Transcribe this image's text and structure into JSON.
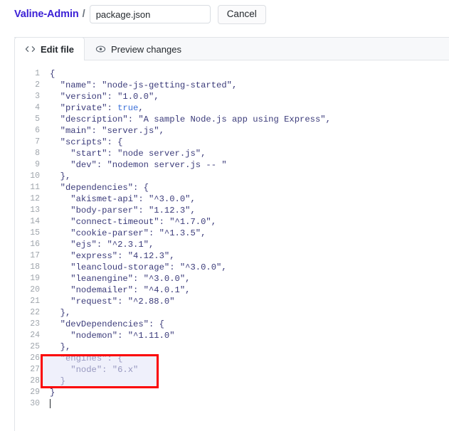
{
  "header": {
    "repo_name": "Valine-Admin",
    "path_separator": "/",
    "filename_value": "package.json",
    "filename_placeholder": "Name your file...",
    "cancel_label": "Cancel"
  },
  "tabs": [
    {
      "label": "Edit file",
      "icon": "code-icon",
      "active": true
    },
    {
      "label": "Preview changes",
      "icon": "eye-icon",
      "active": false
    }
  ],
  "editor": {
    "line_numbers": [
      "1",
      "2",
      "3",
      "4",
      "5",
      "6",
      "7",
      "8",
      "9",
      "10",
      "11",
      "12",
      "13",
      "14",
      "15",
      "16",
      "17",
      "18",
      "19",
      "20",
      "21",
      "22",
      "23",
      "24",
      "25",
      "26",
      "27",
      "28",
      "29",
      "30"
    ],
    "lines": [
      "{",
      "  \"name\": \"node-js-getting-started\",",
      "  \"version\": \"1.0.0\",",
      "  \"private\": true,",
      "  \"description\": \"A sample Node.js app using Express\",",
      "  \"main\": \"server.js\",",
      "  \"scripts\": {",
      "    \"start\": \"node server.js\",",
      "    \"dev\": \"nodemon server.js -- \"",
      "  },",
      "  \"dependencies\": {",
      "    \"akismet-api\": \"^3.0.0\",",
      "    \"body-parser\": \"1.12.3\",",
      "    \"connect-timeout\": \"^1.7.0\",",
      "    \"cookie-parser\": \"^1.3.5\",",
      "    \"ejs\": \"^2.3.1\",",
      "    \"express\": \"4.12.3\",",
      "    \"leancloud-storage\": \"^3.0.0\",",
      "    \"leanengine\": \"^3.0.0\",",
      "    \"nodemailer\": \"^4.0.1\",",
      "    \"request\": \"^2.88.0\"",
      "  },",
      "  \"devDependencies\": {",
      "    \"nodemon\": \"^1.11.0\"",
      "  },",
      "  \"engines\": {",
      "    \"node\": \"6.x\"",
      "  }",
      "}",
      ""
    ],
    "cursor_line": 30,
    "boolean_tokens": [
      "true"
    ]
  },
  "annotation": {
    "kind": "red-rectangle-highlight",
    "color": "#fb0000",
    "covers_lines": "26-28",
    "covers_text": "\"engines\": { \"node\": \"6.x\" }"
  }
}
